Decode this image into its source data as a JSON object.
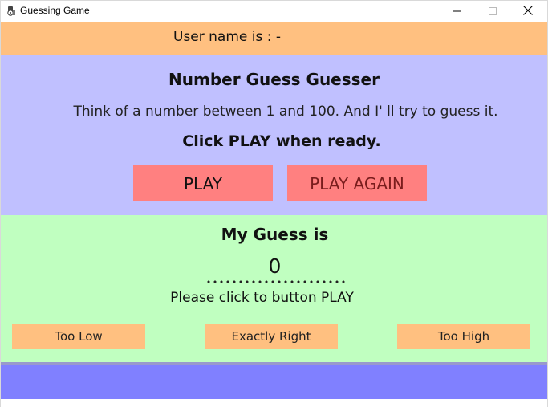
{
  "window": {
    "title": "Guessing Game",
    "icon": "game-icon",
    "controls": {
      "minimize_icon": "minimize-icon",
      "maximize_icon": "maximize-icon",
      "close_icon": "close-icon"
    }
  },
  "user_bar": {
    "label": "User name is : -",
    "color": "#ffc080"
  },
  "intro": {
    "title": "Number Guess Guesser",
    "text": "Think of a number between 1 and 100. And I' ll try to guess it.",
    "cta": "Click PLAY when ready.",
    "play_label": "PLAY",
    "play_again_label": "PLAY AGAIN",
    "color": "#c0c0ff",
    "button_color": "#ff8080"
  },
  "guess": {
    "title": "My Guess is",
    "value": "0",
    "hint": "Please click to button PLAY",
    "too_low_label": "Too Low",
    "exactly_right_label": "Exactly Right",
    "too_high_label": "Too High",
    "color": "#c0ffc0",
    "button_color": "#ffc080"
  },
  "footer": {
    "color": "#8080ff"
  }
}
